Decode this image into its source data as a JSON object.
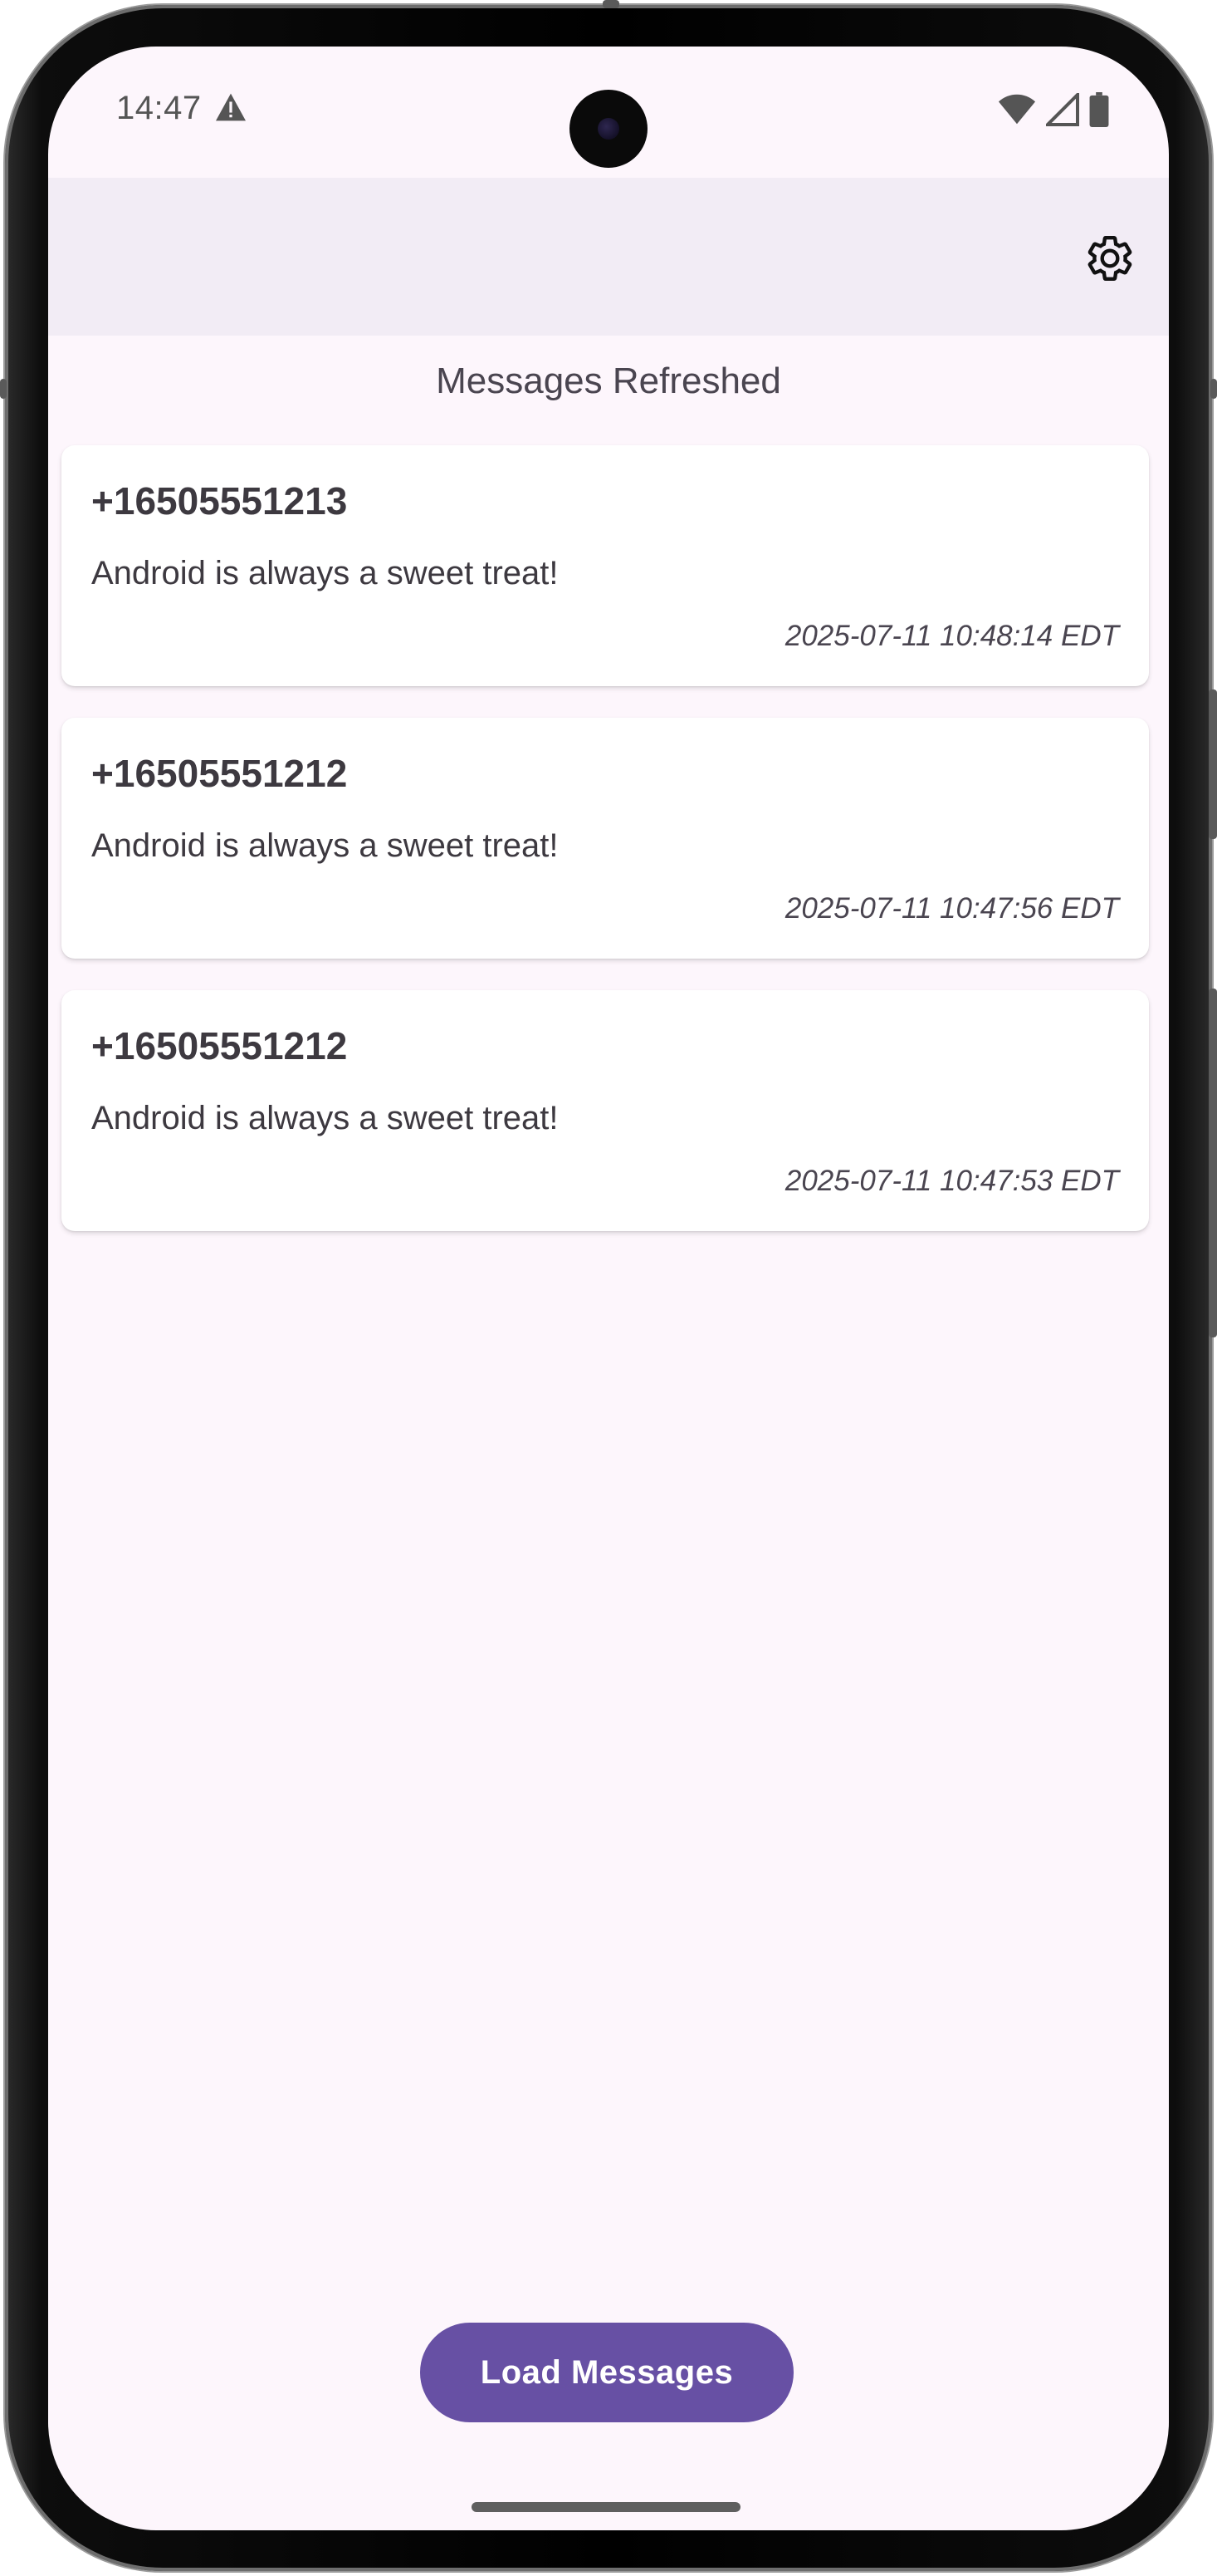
{
  "status_bar": {
    "time": "14:47",
    "icons": [
      "warning-icon",
      "wifi-icon",
      "signal-icon",
      "battery-icon"
    ]
  },
  "app_bar": {
    "settings_icon": "gear-icon"
  },
  "status_message": "Messages Refreshed",
  "messages": [
    {
      "sender": "+16505551213",
      "body": "Android is always a sweet treat!",
      "timestamp": "2025-07-11 10:48:14 EDT"
    },
    {
      "sender": "+16505551212",
      "body": "Android is always a sweet treat!",
      "timestamp": "2025-07-11 10:47:56 EDT"
    },
    {
      "sender": "+16505551212",
      "body": "Android is always a sweet treat!",
      "timestamp": "2025-07-11 10:47:53 EDT"
    }
  ],
  "load_button_label": "Load Messages",
  "colors": {
    "background": "#fdf6fc",
    "app_bar": "#f2ecf5",
    "primary": "#6750a4",
    "card": "#ffffff"
  }
}
